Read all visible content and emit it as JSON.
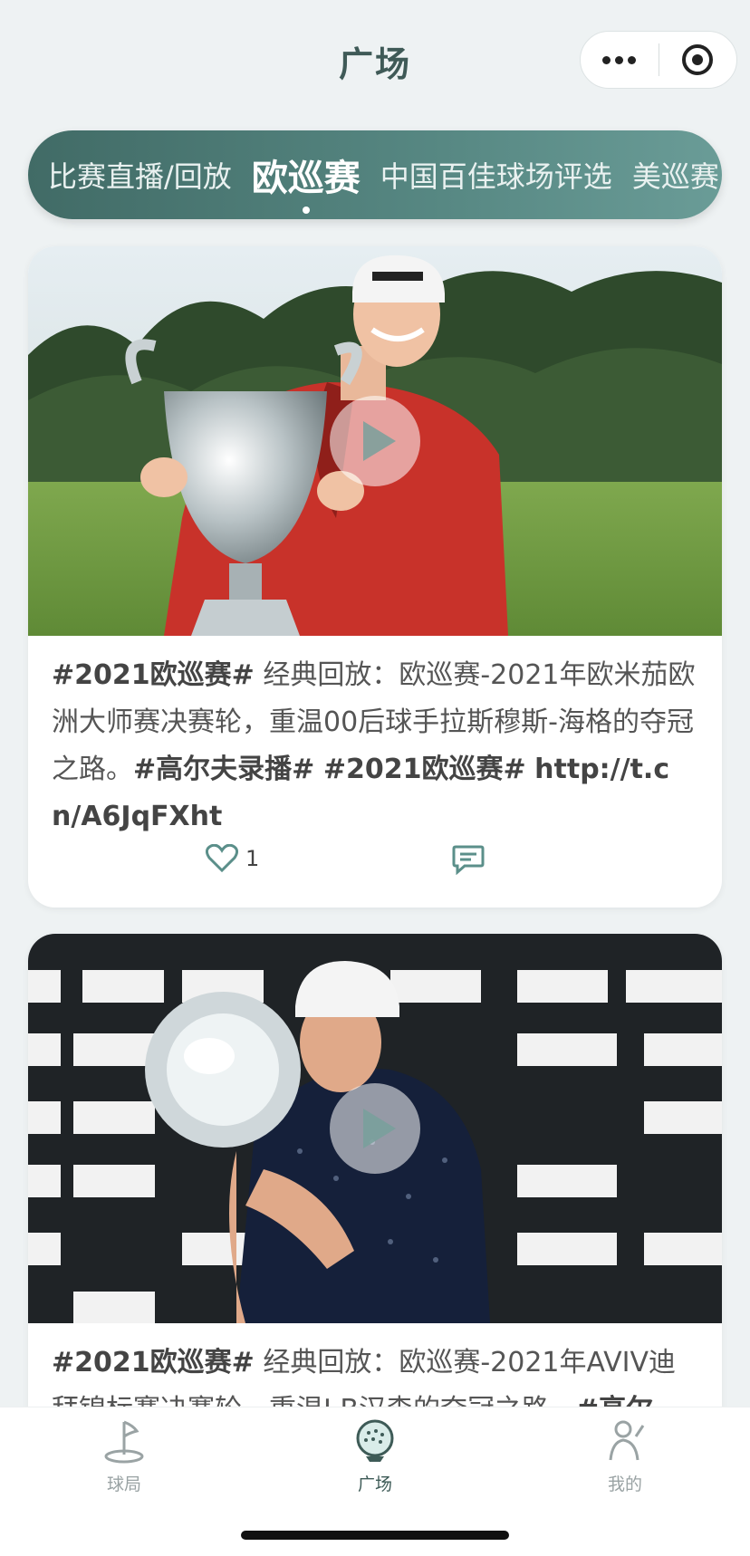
{
  "header": {
    "title": "广场",
    "more_icon": "more-dots-icon",
    "close_icon": "target-circle-icon"
  },
  "tabs": [
    {
      "label": "比赛直播/回放",
      "active": false
    },
    {
      "label": "欧巡赛",
      "active": true
    },
    {
      "label": "中国百佳球场评选",
      "active": false
    },
    {
      "label": "美巡赛",
      "active": false
    }
  ],
  "posts": [
    {
      "segments": [
        {
          "t": "#2021欧巡赛#",
          "tag": true
        },
        {
          "t": " 经典回放：欧巡赛-2021年欧米茄欧洲大师赛决赛轮，重温00后球手拉斯穆斯-海格的夺冠之路。",
          "tag": false
        },
        {
          "t": "#高尔夫录播#",
          "tag": true
        },
        {
          "t": " ",
          "tag": false
        },
        {
          "t": "#2021欧巡赛#",
          "tag": true
        },
        {
          "t": " ",
          "tag": false
        },
        {
          "t": "http://t.cn/A6JqFXht",
          "tag": true
        }
      ],
      "likes": "1"
    },
    {
      "segments": [
        {
          "t": "#2021欧巡赛#",
          "tag": true
        },
        {
          "t": " 经典回放：欧巡赛-2021年AVIV迪拜锦标赛决赛轮，重温J.B汉森的夺冠之路。",
          "tag": false
        },
        {
          "t": "#高尔",
          "tag": true
        }
      ],
      "likes": ""
    }
  ],
  "tabbar": {
    "items": [
      {
        "label": "球局",
        "icon": "flag-hole-icon",
        "active": false
      },
      {
        "label": "广场",
        "icon": "golf-ball-icon",
        "active": true
      },
      {
        "label": "我的",
        "icon": "golfer-profile-icon",
        "active": false
      }
    ]
  },
  "colors": {
    "accent": "#578883",
    "title": "#3f5a57",
    "inactive": "#9aa3a4"
  }
}
